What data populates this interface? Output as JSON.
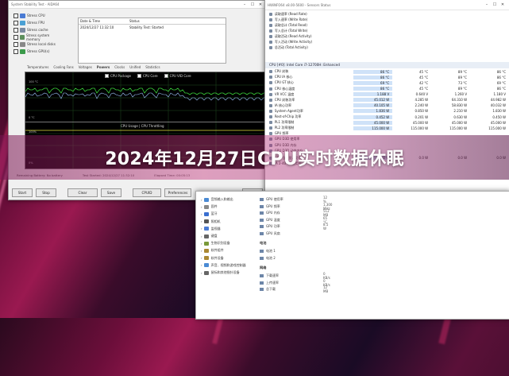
{
  "headline": "2024年12月27日CPU实时数据休眠",
  "stress_window": {
    "title": "System Stability Test - AIDA64",
    "checks": [
      {
        "label": "Stress CPU",
        "color": "#4a7bd4"
      },
      {
        "label": "Stress FPU",
        "color": "#4aa0d4"
      },
      {
        "label": "Stress cache",
        "color": "#7a8aa0"
      },
      {
        "label": "Stress system memory",
        "color": "#5c8f5c"
      },
      {
        "label": "Stress local disks",
        "color": "#888888"
      },
      {
        "label": "Stress GPU(s)",
        "color": "#3a9a4a"
      }
    ],
    "info": [
      {
        "k": "Date & Time",
        "v": "Status"
      },
      {
        "k": "2024/12/27 11:32:10",
        "v": "Stability Test: Started"
      }
    ],
    "tabs": [
      "Temperatures",
      "Cooling Fans",
      "Voltages",
      "Powers",
      "Clocks",
      "Unified",
      "Statistics"
    ],
    "graph_legend": [
      "CPU Package",
      "CPU Core",
      "CPU VID Core"
    ],
    "graph1": {
      "top_label": "100 °C",
      "bottom_label": "0 °C"
    },
    "graph2": {
      "title": "CPU Usage | CPU Throttling",
      "top_label": "100%",
      "bottom_label": "0%"
    },
    "stats": {
      "battery": "Remaining Battery:",
      "battery_val": "No battery",
      "started": "Test Started:",
      "started_val": "2024/12/27 11:32:10",
      "elapsed": "Elapsed Time:",
      "elapsed_val": "00:05:13"
    },
    "buttons": [
      "Start",
      "Stop",
      "Clear",
      "Save",
      "CPUID",
      "Preferences",
      "Close"
    ]
  },
  "hw_window": {
    "title": "HWiNFO64 v8.00-5600 - Sensors Status",
    "top_rows": [
      {
        "name": "读取速率 (Read Rate)",
        "v": [
          "",
          "",
          "",
          ""
        ]
      },
      {
        "name": "写入速率 (Write Rate)",
        "v": [
          "",
          "",
          "",
          ""
        ]
      },
      {
        "name": "读取总计 (Total Read)",
        "v": [
          "",
          "",
          "",
          ""
        ]
      },
      {
        "name": "写入总计 (Total Write)",
        "v": [
          "",
          "",
          "",
          ""
        ]
      },
      {
        "name": "读取活动 (Read Activity)",
        "v": [
          "",
          "",
          "",
          ""
        ]
      },
      {
        "name": "写入活动 (Write Activity)",
        "v": [
          "",
          "",
          "",
          ""
        ]
      },
      {
        "name": "总活动 (Total Activity)",
        "v": [
          "",
          "",
          "",
          ""
        ]
      }
    ],
    "section": "CPU [#0]: Intel Core i7-12700H: Enhanced",
    "rows": [
      {
        "name": "CPU 封装",
        "v": [
          "86 °C",
          "45 °C",
          "89 °C",
          "86 °C"
        ]
      },
      {
        "name": "CPU IA 核心",
        "v": [
          "86 °C",
          "45 °C",
          "89 °C",
          "86 °C"
        ]
      },
      {
        "name": "CPU GT 核心",
        "v": [
          "69 °C",
          "42 °C",
          "73 °C",
          "69 °C"
        ]
      },
      {
        "name": "CPU 核心温度",
        "v": [
          "86 °C",
          "45 °C",
          "89 °C",
          "86 °C"
        ]
      },
      {
        "name": "VR VCC 温度",
        "v": [
          "1.188 V",
          "0.640 V",
          "1.260 V",
          "1.180 V"
        ]
      },
      {
        "name": "CPU 封装功率",
        "v": [
          "45.012 W",
          "4.285 W",
          "64.310 W",
          "44.982 W"
        ]
      },
      {
        "name": "IA 核心功率",
        "v": [
          "40.105 W",
          "2.240 W",
          "58.830 W",
          "40.032 W"
        ]
      },
      {
        "name": "System Agent功率",
        "v": [
          "1.836 W",
          "0.850 W",
          "2.210 W",
          "1.830 W"
        ]
      },
      {
        "name": "Rest-of-Chip 功率",
        "v": [
          "0.452 W",
          "0.201 W",
          "0.630 W",
          "0.450 W"
        ]
      },
      {
        "name": "PL1 功率限制",
        "v": [
          "45.000 W",
          "45.000 W",
          "45.000 W",
          "45.000 W"
        ]
      },
      {
        "name": "PL2 功率限制",
        "v": [
          "115.000 W",
          "115.000 W",
          "115.000 W",
          "115.000 W"
        ]
      },
      {
        "name": "GPU 频率",
        "v": [
          "",
          "",
          "",
          ""
        ]
      },
      {
        "name": "GPU D3D 使用率",
        "v": [
          "",
          "",
          "",
          ""
        ]
      },
      {
        "name": "GPU D3D 内存",
        "v": [
          "",
          "",
          "",
          ""
        ]
      },
      {
        "name": "GPU D3D 动态内存",
        "v": [
          "",
          "",
          "",
          ""
        ]
      }
    ],
    "bottom_rows": [
      {
        "name": "GPU 当前显示功率",
        "v": [
          "0.0 W",
          "0.0 W",
          "0.0 W",
          "0.0 W"
        ]
      },
      {
        "name": "IA 2-40-26 使用率",
        "v": [
          "",
          "",
          "",
          ""
        ]
      }
    ],
    "toolbar_time": "0:05:14"
  },
  "device_window": {
    "tree": [
      {
        "label": "音频输入和输出",
        "color": "#4a8ad4"
      },
      {
        "label": "固件",
        "color": "#888888"
      },
      {
        "label": "蓝牙",
        "color": "#3a6fd0"
      },
      {
        "label": "照相机",
        "color": "#555555"
      },
      {
        "label": "监视器",
        "color": "#4a7bd4"
      },
      {
        "label": "键盘",
        "color": "#666666"
      },
      {
        "label": "生物识别设备",
        "color": "#7a9a3a"
      },
      {
        "label": "软件组件",
        "color": "#aa8833"
      },
      {
        "label": "软件设备",
        "color": "#aa8833"
      },
      {
        "label": "声音、视频和游戏控制器",
        "color": "#4a8ad4"
      },
      {
        "label": "鼠标和其他指针设备",
        "color": "#666666"
      }
    ],
    "right_rows": [
      {
        "name": "GPU 使用率",
        "val": "12 %"
      },
      {
        "name": "GPU 频率",
        "val": "1,300 MHz"
      },
      {
        "name": "GPU 内存",
        "val": "512 MB"
      },
      {
        "name": "GPU 温度",
        "val": "65 °C"
      },
      {
        "name": "GPU 功率",
        "val": "8.5 W"
      },
      {
        "name": "GPU 风扇",
        "val": ""
      }
    ],
    "sec1": "电池",
    "sec1_rows": [
      {
        "name": "电池 1",
        "val": ""
      },
      {
        "name": "电池 2",
        "val": ""
      }
    ],
    "sec2": "网络",
    "sec2_rows": [
      {
        "name": "下载速率",
        "val": "0 KB/s"
      },
      {
        "name": "上传速率",
        "val": "0 KB/s"
      },
      {
        "name": "总下载",
        "val": "12 MB"
      }
    ]
  }
}
